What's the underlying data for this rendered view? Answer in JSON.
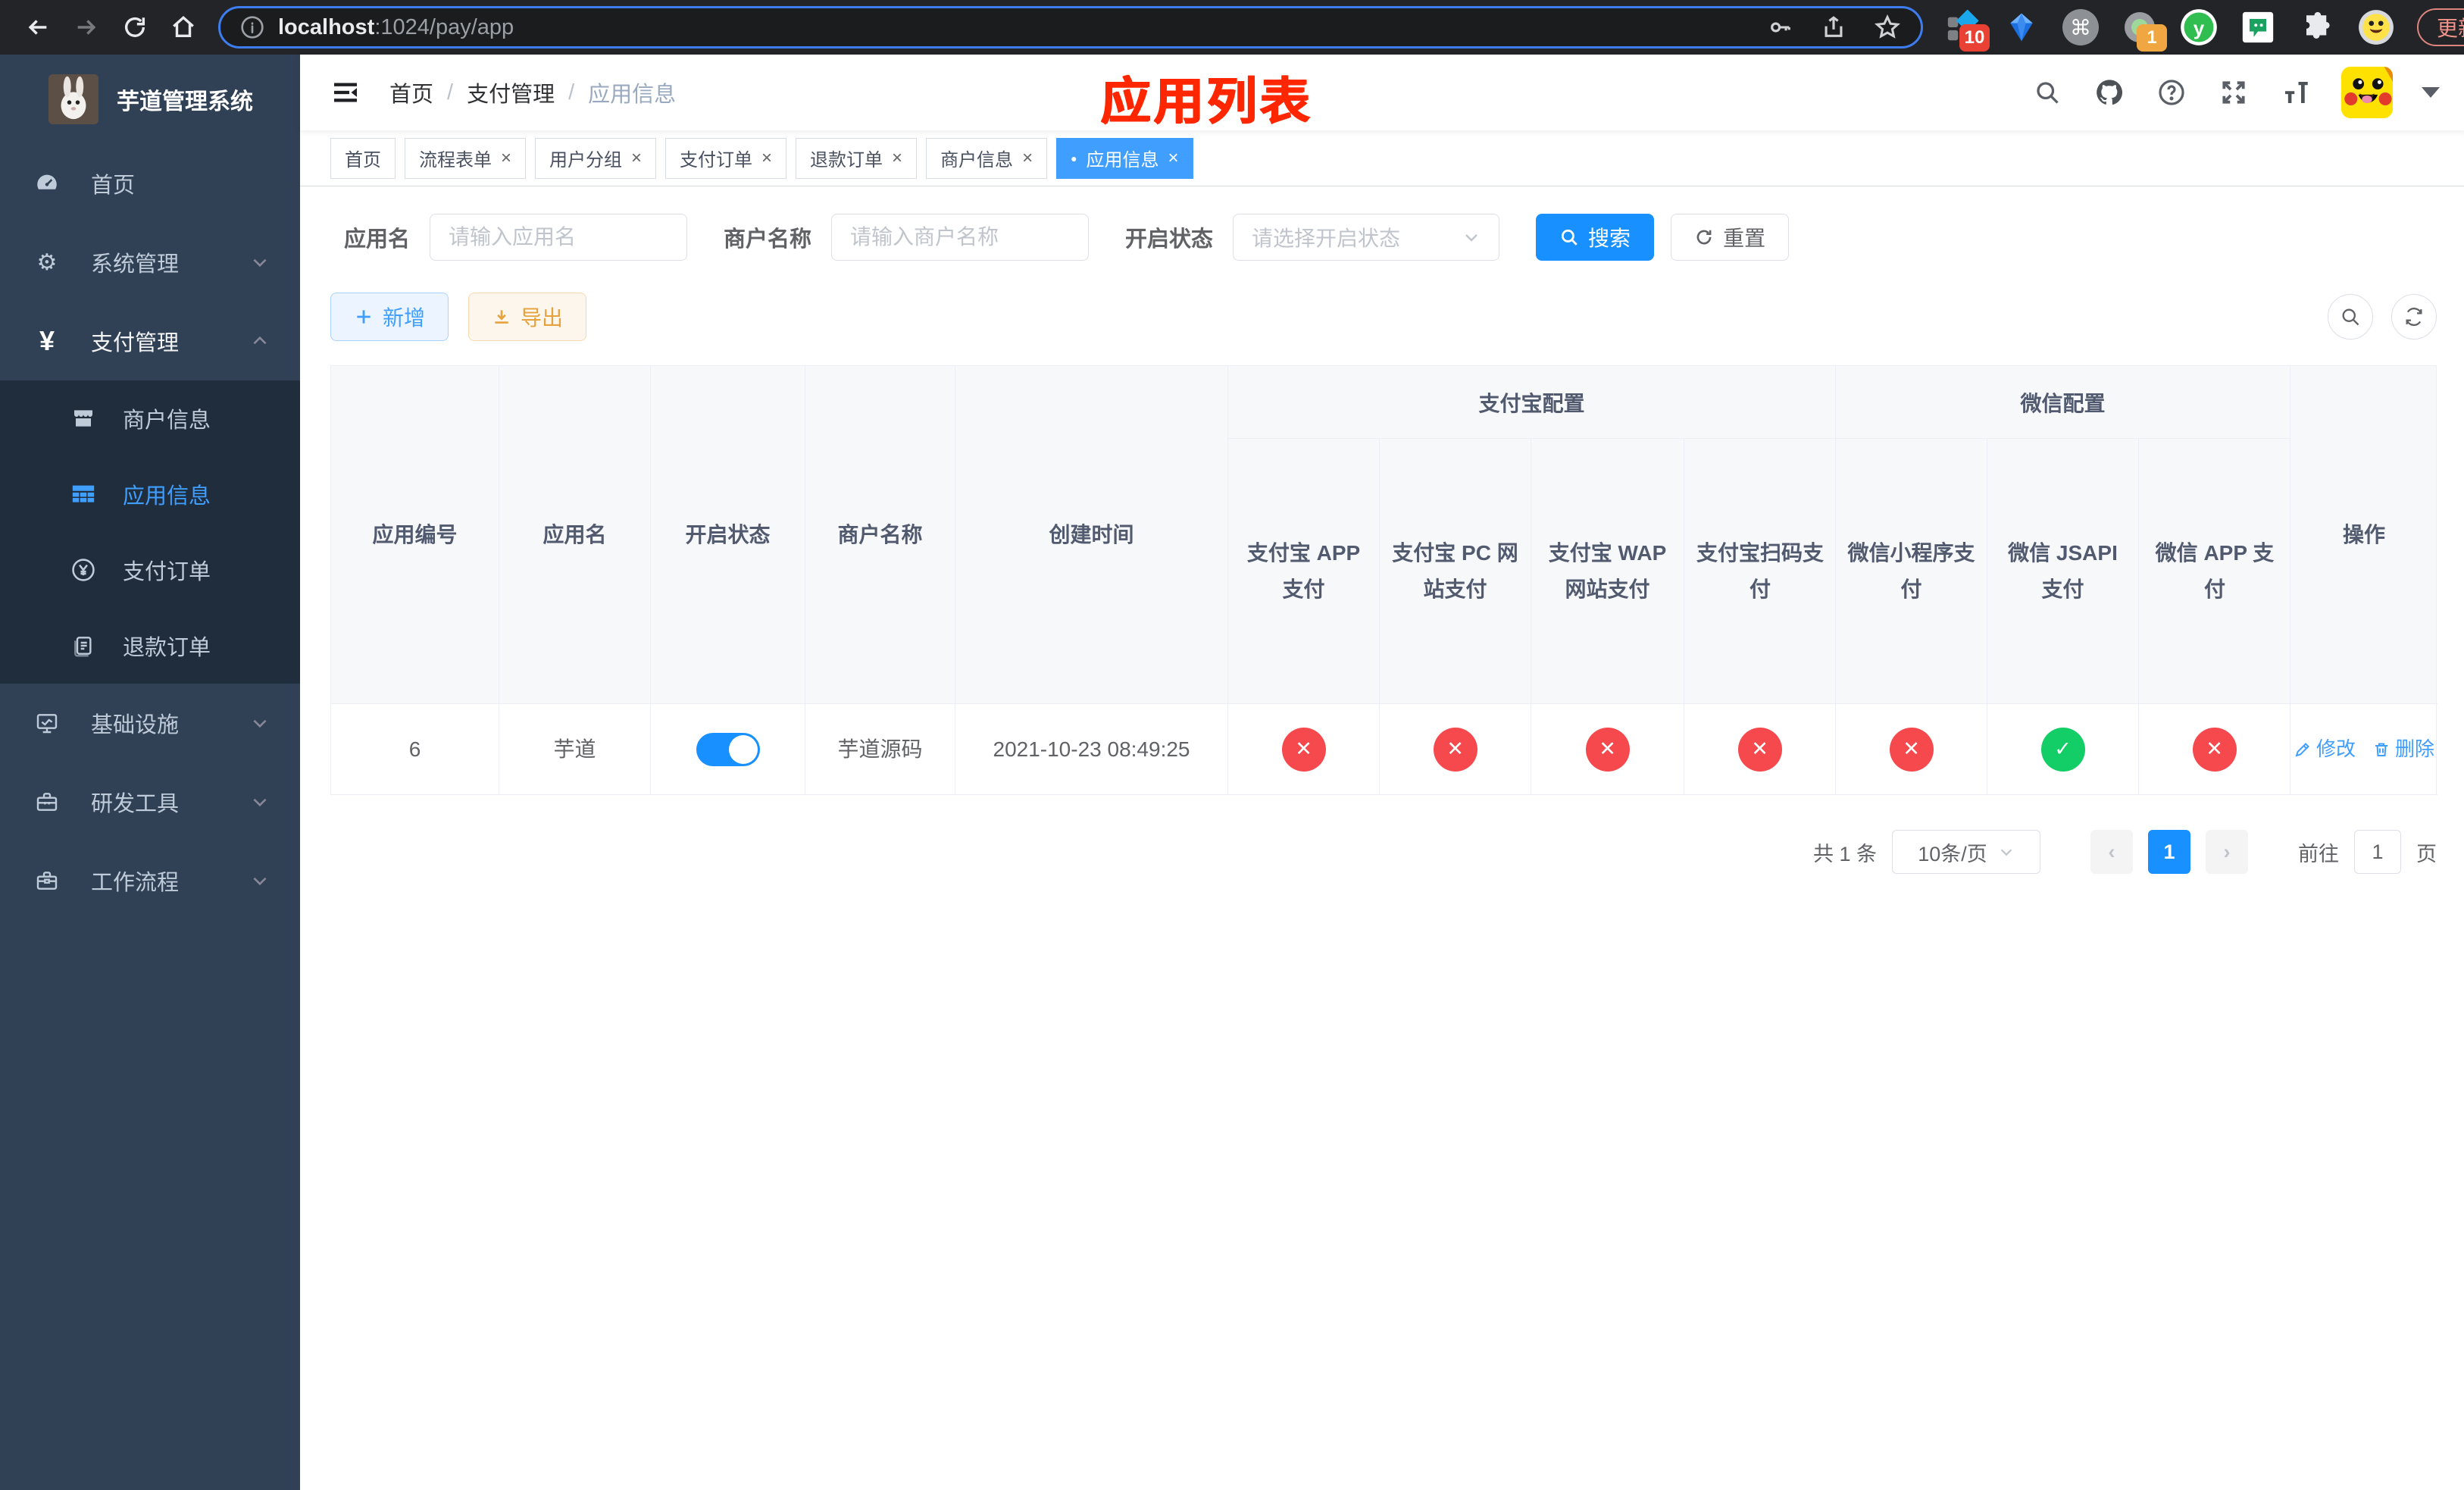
{
  "colors": {
    "primary": "#409eff",
    "bright_blue": "#1890ff",
    "success": "#13ce66",
    "danger": "#f5494d",
    "sidebar_bg": "#304156",
    "submenu_bg": "#1f2d3d",
    "warning": "#e6a23c"
  },
  "icons": {
    "close": "×",
    "dot": "●",
    "gear": "⚙",
    "yen": "¥",
    "cross": "✕",
    "check": "✓",
    "more": "⋮",
    "star": "☆",
    "prev": "‹",
    "next": "›",
    "command": "⌘",
    "plus": "+",
    "question": "?",
    "info": "i",
    "y_letter": "y"
  },
  "browser": {
    "url_host": "localhost",
    "url_path": ":1024/pay/app",
    "extension_badge_a": "10",
    "extension_badge_b": "1",
    "update_button": "更新"
  },
  "sidebar": {
    "title": "芋道管理系统",
    "menu": [
      {
        "label": "首页"
      },
      {
        "label": "系统管理"
      },
      {
        "label": "支付管理"
      },
      {
        "label": "基础设施"
      },
      {
        "label": "研发工具"
      },
      {
        "label": "工作流程"
      }
    ],
    "submenu": [
      {
        "label": "商户信息"
      },
      {
        "label": "应用信息"
      },
      {
        "label": "支付订单"
      },
      {
        "label": "退款订单"
      }
    ]
  },
  "header": {
    "breadcrumb": [
      "首页",
      "支付管理",
      "应用信息"
    ],
    "annotation": "应用列表"
  },
  "tabs": [
    {
      "label": "首页"
    },
    {
      "label": "流程表单"
    },
    {
      "label": "用户分组"
    },
    {
      "label": "支付订单"
    },
    {
      "label": "退款订单"
    },
    {
      "label": "商户信息"
    },
    {
      "label": "应用信息"
    }
  ],
  "filters": {
    "app_name_label": "应用名",
    "app_name_placeholder": "请输入应用名",
    "merchant_label": "商户名称",
    "merchant_placeholder": "请输入商户名称",
    "status_label": "开启状态",
    "status_placeholder": "请选择开启状态",
    "search_button": "搜索",
    "reset_button": "重置"
  },
  "toolbar": {
    "add_button": "新增",
    "export_button": "导出"
  },
  "table": {
    "columns": [
      "应用编号",
      "应用名",
      "开启状态",
      "商户名称",
      "创建时间"
    ],
    "groups": [
      {
        "label": "支付宝配置",
        "children": [
          "支付宝 APP 支付",
          "支付宝 PC 网站支付",
          "支付宝 WAP 网站支付",
          "支付宝扫码支付"
        ]
      },
      {
        "label": "微信配置",
        "children": [
          "微信小程序支付",
          "微信 JSAPI 支付",
          "微信 APP 支付"
        ]
      }
    ],
    "action_column": "操作",
    "row": {
      "id": "6",
      "name": "芋道",
      "enabled": true,
      "merchant": "芋道源码",
      "created": "2021-10-23 08:49:25",
      "statuses": [
        "no",
        "no",
        "no",
        "no",
        "no",
        "yes",
        "no"
      ],
      "edit": "修改",
      "delete": "删除"
    }
  },
  "pagination": {
    "total": "共 1 条",
    "page_size": "10条/页",
    "page": "1",
    "goto_label": "前往",
    "goto_value": "1",
    "goto_unit": "页"
  }
}
